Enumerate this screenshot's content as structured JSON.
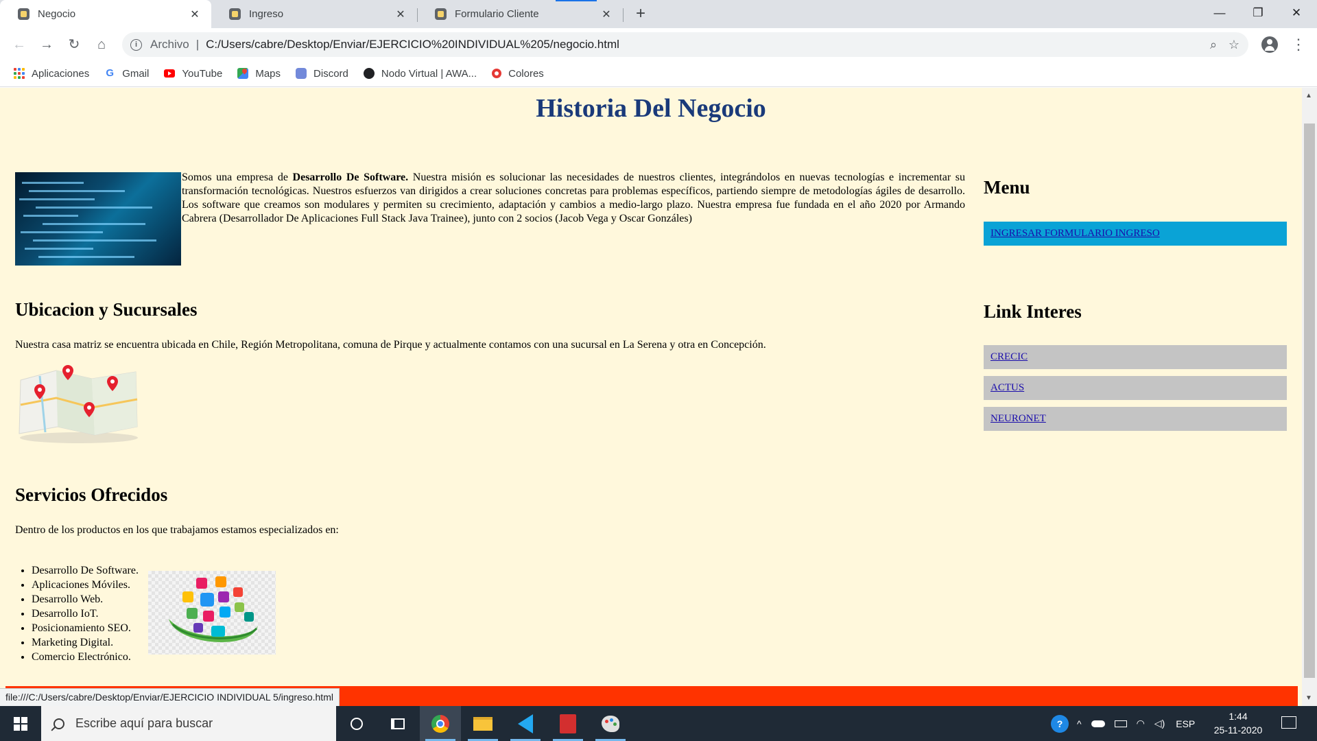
{
  "browser": {
    "tabs": [
      {
        "title": "Negocio",
        "active": true
      },
      {
        "title": "Ingreso",
        "active": false
      },
      {
        "title": "Formulario Cliente",
        "active": false
      }
    ],
    "tab_close": "✕",
    "new_tab": "+",
    "window_controls": {
      "minimize": "—",
      "maximize": "❐",
      "close": "✕"
    },
    "nav": {
      "back": "←",
      "forward": "→",
      "reload": "↻",
      "home": "⌂"
    },
    "address": {
      "scheme_label": "Archivo",
      "separator": "|",
      "url": "C:/Users/cabre/Desktop/Enviar/EJERCICIO%20INDIVIDUAL%205/negocio.html"
    },
    "omnibox_icons": {
      "zoom": "⌕",
      "bookmark_star": "☆"
    },
    "menu_glyph": "⋮",
    "bookmarks": [
      {
        "label": "Aplicaciones",
        "icon": "apps-grid-icon"
      },
      {
        "label": "Gmail",
        "icon": "google-g-icon",
        "color": "#4285f4"
      },
      {
        "label": "YouTube",
        "icon": "youtube-icon",
        "color": "#ff0000"
      },
      {
        "label": "Maps",
        "icon": "maps-icon",
        "color": "#34a853"
      },
      {
        "label": "Discord",
        "icon": "discord-icon",
        "color": "#7289da"
      },
      {
        "label": "Nodo Virtual | AWA...",
        "icon": "nodo-virtual-icon",
        "color": "#202124"
      },
      {
        "label": "Colores",
        "icon": "colores-icon",
        "color": "#e53935"
      }
    ]
  },
  "page": {
    "title": "Historia Del Negocio",
    "intro": {
      "prefix": "Somos una empresa de ",
      "bold": "Desarrollo De Software.",
      "rest": " Nuestra misión es solucionar las necesidades de nuestros clientes, integrándolos en nuevas tecnologías e incrementar su transformación tecnológicas. Nuestros esfuerzos van dirigidos a crear soluciones concretas para problemas específicos, partiendo siempre de metodologías ágiles de desarrollo. Los software que creamos son modulares y permiten su crecimiento, adaptación y cambios a medio-largo plazo. Nuestra empresa fue fundada en el año 2020 por Armando Cabrera (Desarrollador De Aplicaciones Full Stack Java Trainee), junto con 2 socios (Jacob Vega y Oscar Gonzáles)"
    },
    "location": {
      "heading": "Ubicacion y Sucursales",
      "text": "Nuestra casa matriz se encuentra ubicada en Chile, Región Metropolitana, comuna de Pirque y actualmente contamos con una sucursal en La Serena y otra en Concepción."
    },
    "services": {
      "heading": "Servicios Ofrecidos",
      "text": "Dentro de los productos en los que trabajamos estamos especializados en:",
      "items": [
        "Desarrollo De Software.",
        "Aplicaciones Móviles.",
        "Desarrollo Web.",
        "Desarrollo IoT.",
        "Posicionamiento SEO.",
        "Marketing Digital.",
        "Comercio Electrónico."
      ]
    },
    "aside": {
      "menu_heading": "Menu",
      "menu_links": [
        "INGRESAR FORMULARIO INGRESO"
      ],
      "interest_heading": "Link Interes",
      "interest_links": [
        "CRECIC",
        "ACTUS",
        "NEURONET"
      ]
    },
    "colors": {
      "background": "#fff8dc",
      "title": "#1a3a7a",
      "menu_link_bg": "#0aa3d6",
      "interest_link_bg": "#c4c4c4",
      "footer": "#ff3300"
    }
  },
  "status_url": "file:///C:/Users/cabre/Desktop/Enviar/EJERCICIO INDIVIDUAL 5/ingreso.html",
  "taskbar": {
    "search_placeholder": "Escribe aquí para buscar",
    "apps": [
      "task-view-icon",
      "chrome-icon",
      "file-explorer-icon",
      "vscode-icon",
      "acrobat-icon",
      "paint-icon"
    ],
    "language": "ESP",
    "time": "1:44",
    "date": "25-11-2020"
  }
}
